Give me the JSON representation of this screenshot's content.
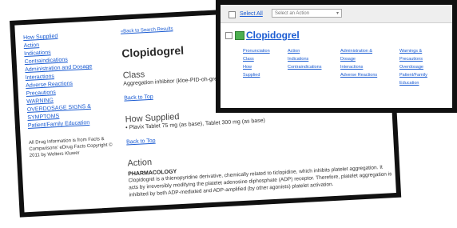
{
  "back": {
    "nav": [
      "How Supplied",
      "Action",
      "Indications",
      "Contraindications",
      "Administration and Dosage",
      "Interactions",
      "Adverse Reactions",
      "Precautions",
      "WARNING",
      "OVERDOSAGE SIGNS & SYMPTOMS",
      "Patient/Family Education"
    ],
    "footer": "All Drug Information is from Facts & Comparisons' eDrug Facts Copyright © 2011 by Wolters Kluwer",
    "back_link": "«Back to Search Results",
    "title": "Clopidogrel",
    "class_heading": "Class",
    "class_text": "Aggregation inhibitor (kloe-PID-oh-grel)",
    "back_to_top": "Back to Top",
    "supplied_heading": "How Supplied",
    "supplied_text": "Plavix Tablet 75 mg (as base), Tablet 300 mg (as base)",
    "action_heading": "Action",
    "pharm_heading": "PHARMACOLOGY",
    "pharm_text": "Clopidogrel is a thienopyridine derivative, chemically related to ticlopidine, which inhibits platelet aggregation. It acts by irreversibly modifying the platelet adenosine diphosphate (ADP) receptor. Therefore, platelet aggregation is inhibited by both ADP-mediated and ADP-amplified (by other agonists) platelet activation."
  },
  "front": {
    "select_all": "Select All",
    "action_placeholder": "Select an Action",
    "result_title": "Clopidogrel",
    "links": [
      [
        "Pronunciation",
        "Action",
        "Administration &",
        "Warnings &"
      ],
      [
        "Class",
        "Indications",
        "Dosage",
        "Precautions"
      ],
      [
        "How",
        "Contraindications",
        "Interactions",
        "Overdosage"
      ],
      [
        "Supplied",
        "",
        "Adverse Reactions",
        "Patient/Family"
      ],
      [
        "",
        "",
        "",
        "Education"
      ]
    ]
  }
}
